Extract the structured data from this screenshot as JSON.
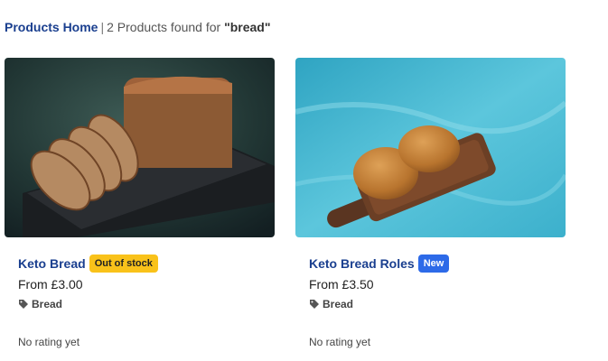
{
  "breadcrumb": {
    "home_label": "Products Home",
    "separator": "|",
    "count_text": "2 Products found for",
    "query": "\"bread\""
  },
  "products": [
    {
      "title": "Keto Bread",
      "badge": "Out of stock",
      "price": "From £3.00",
      "category": "Bread",
      "rating": "No rating yet"
    },
    {
      "title": "Keto Bread Roles",
      "badge": "New",
      "price": "From £3.50",
      "category": "Bread",
      "rating": "No rating yet"
    }
  ],
  "colors": {
    "link": "#1a3f8f",
    "badge_out_of_stock": "#f9c21a",
    "badge_new": "#2d6ae8"
  },
  "icons": [
    "tag-icon"
  ]
}
